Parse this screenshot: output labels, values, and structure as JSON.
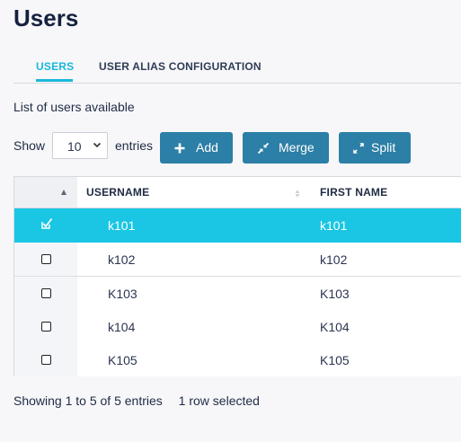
{
  "page": {
    "title": "Users"
  },
  "tabs": [
    {
      "label": "USERS",
      "active": true
    },
    {
      "label": "USER ALIAS CONFIGURATION",
      "active": false
    }
  ],
  "list_label": "List of users available",
  "length_menu": {
    "prefix": "Show",
    "value": "10",
    "suffix": "entries"
  },
  "buttons": {
    "add": "Add",
    "merge": "Merge",
    "split": "Split"
  },
  "table": {
    "headers": {
      "username": "USERNAME",
      "first_name": "FIRST NAME"
    },
    "rows": [
      {
        "username": "k101",
        "first_name": "k101",
        "selected": true
      },
      {
        "username": "k102",
        "first_name": "k102",
        "selected": false
      },
      {
        "username": "K103",
        "first_name": "K103",
        "selected": false
      },
      {
        "username": "k104",
        "first_name": "K104",
        "selected": false
      },
      {
        "username": "K105",
        "first_name": "K105",
        "selected": false
      }
    ]
  },
  "footer": {
    "info": "Showing 1 to 5 of 5 entries",
    "selected": "1 row selected"
  },
  "colors": {
    "accent": "#1ab7dc",
    "selected_row": "#1ac6e4",
    "button": "#2c7fa6",
    "title": "#16213f"
  }
}
